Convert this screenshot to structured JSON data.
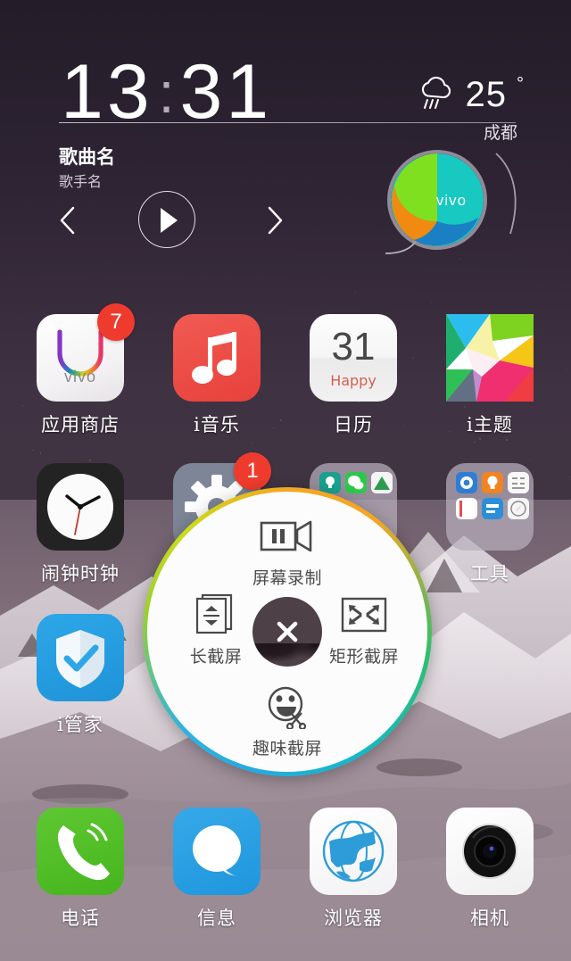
{
  "statusbar": {
    "visible": false
  },
  "lockscreen": {
    "time": {
      "hours": "13",
      "separator": ":",
      "minutes": "31"
    },
    "weather": {
      "icon": "rain-cloud-icon",
      "temperature": "25",
      "degree_symbol": "°",
      "city": "成都"
    }
  },
  "music_widget": {
    "title": "歌曲名",
    "artist": "歌手名",
    "controls": {
      "previous": "previous-track-icon",
      "play": "play-icon",
      "next": "next-track-icon"
    },
    "album_art_brand": "vivo",
    "album_colors": [
      "#7fe01f",
      "#17c9c1",
      "#f18a10",
      "#1b7fc4"
    ]
  },
  "home": {
    "rows": [
      [
        {
          "label": "应用商店",
          "icon": "app-store-icon",
          "badge": "7",
          "brand": "vivo"
        },
        {
          "label": "i音乐",
          "icon": "music-note-icon",
          "badge": null
        },
        {
          "label": "日历",
          "icon": "calendar-icon",
          "badge": null,
          "day": "31",
          "sub": "Happy"
        },
        {
          "label": "i主题",
          "icon": "theme-icon",
          "badge": null
        }
      ],
      [
        {
          "label": "闹钟时钟",
          "icon": "alarm-clock-icon",
          "badge": null
        },
        {
          "label": "",
          "icon": "settings-gear-icon",
          "badge": "1"
        },
        {
          "label": "",
          "icon": "folder-icon",
          "badge": null
        },
        {
          "label": "工具",
          "icon": "folder-tools-icon",
          "badge": null
        }
      ],
      [
        {
          "label": "i管家",
          "icon": "shield-check-icon",
          "badge": null
        }
      ]
    ],
    "dock": [
      {
        "label": "电话",
        "icon": "phone-icon"
      },
      {
        "label": "信息",
        "icon": "message-bubble-icon"
      },
      {
        "label": "浏览器",
        "icon": "globe-icon"
      },
      {
        "label": "相机",
        "icon": "camera-icon"
      }
    ]
  },
  "radial_menu": {
    "close_label": "close-icon",
    "items": {
      "top": {
        "label": "屏幕录制",
        "icon": "screen-record-icon"
      },
      "left": {
        "label": "长截屏",
        "icon": "long-screenshot-icon"
      },
      "right": {
        "label": "矩形截屏",
        "icon": "rect-screenshot-icon"
      },
      "bottom": {
        "label": "趣味截屏",
        "icon": "fun-screenshot-icon"
      }
    },
    "ring_colors": [
      "#f5a623",
      "#2cbf6f",
      "#25aae1",
      "#cbdc1a"
    ]
  },
  "colors": {
    "badge_red": "#ef3b2d",
    "label_white": "#ffffff",
    "sky": "#241c29",
    "mountain": "#8c7b86"
  }
}
